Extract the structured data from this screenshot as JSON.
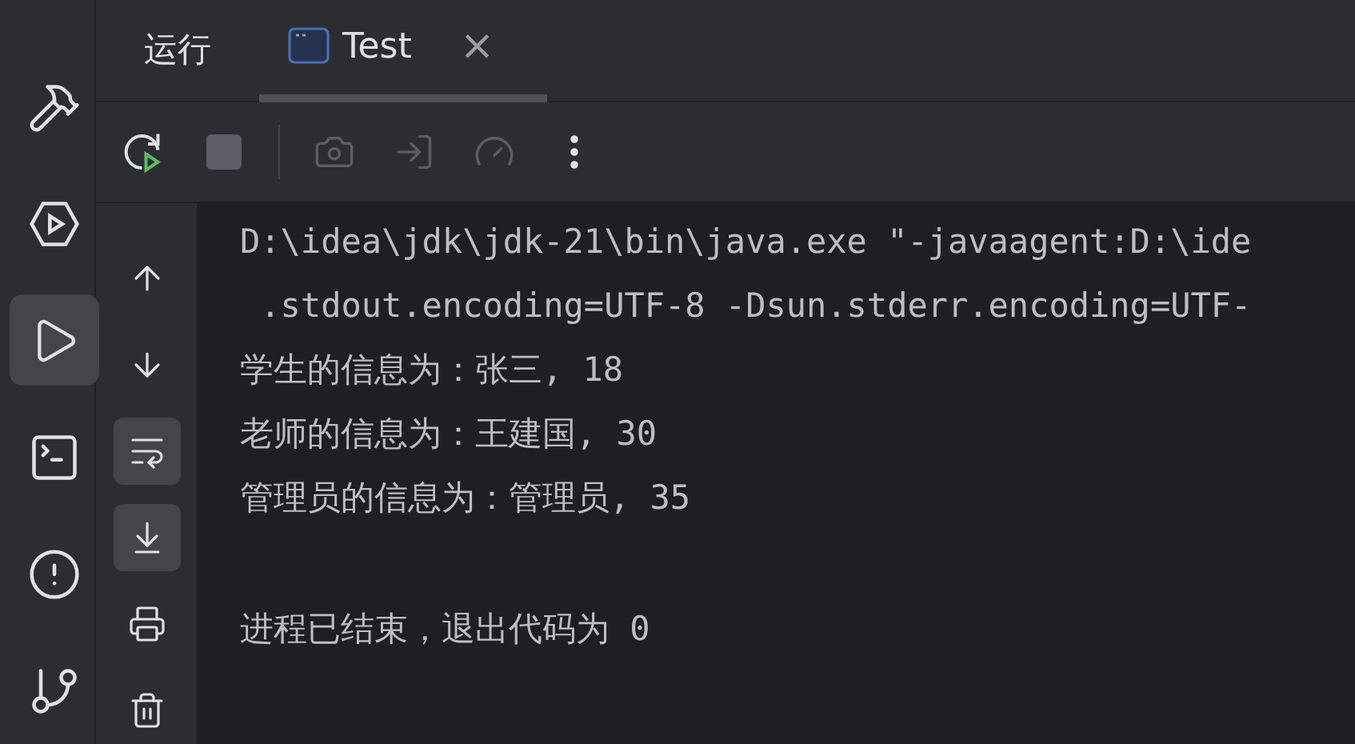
{
  "left_toolbar": [
    {
      "kind": "hammer",
      "selected": false
    },
    {
      "kind": "hex-play",
      "selected": false
    },
    {
      "kind": "play",
      "selected": true
    },
    {
      "kind": "terminal",
      "selected": false
    },
    {
      "kind": "alert",
      "selected": false
    },
    {
      "kind": "branch",
      "selected": false
    }
  ],
  "tool_window": {
    "title": "运行",
    "tabs": [
      {
        "label": "Test",
        "close": "×",
        "selected": true
      }
    ]
  },
  "run_actions": [
    {
      "kind": "rerun",
      "disabled": false
    },
    {
      "kind": "stop",
      "disabled": true
    }
  ],
  "run_tools": [
    {
      "kind": "camera",
      "disabled": true
    },
    {
      "kind": "attach",
      "disabled": true
    },
    {
      "kind": "gauge",
      "disabled": true
    },
    {
      "kind": "more",
      "disabled": false
    }
  ],
  "console_gutter": [
    {
      "kind": "up",
      "on": false
    },
    {
      "kind": "down",
      "on": false
    },
    {
      "kind": "wrap",
      "on": true
    },
    {
      "kind": "scroll-end",
      "on": true
    },
    {
      "kind": "print",
      "on": false
    },
    {
      "kind": "trash",
      "on": false
    }
  ],
  "console_lines": [
    "D:\\idea\\jdk\\jdk-21\\bin\\java.exe \"-javaagent:D:\\ide",
    " .stdout.encoding=UTF-8 -Dsun.stderr.encoding=UTF-",
    "学生的信息为：张三, 18",
    "老师的信息为：王建国, 30",
    "管理员的信息为：管理员, 35"
  ],
  "exit_message": "进程已结束，退出代码为 0"
}
